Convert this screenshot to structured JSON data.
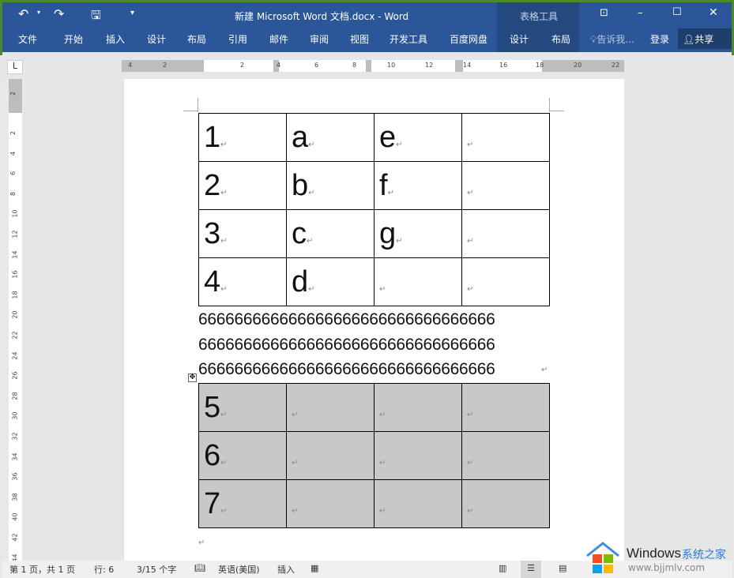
{
  "window": {
    "title": "新建 Microsoft Word 文档.docx - Word",
    "context_group": "表格工具"
  },
  "tabs": [
    "文件",
    "开始",
    "插入",
    "设计",
    "布局",
    "引用",
    "邮件",
    "审阅",
    "视图",
    "开发工具",
    "百度网盘"
  ],
  "context_tabs": [
    "设计",
    "布局"
  ],
  "tell_me": "告诉我...",
  "login": "登录",
  "share": "共享",
  "ruler": {
    "h_ticks": [
      "4",
      "2",
      "2",
      "4",
      "6",
      "8",
      "10",
      "12",
      "14",
      "16",
      "18",
      "20",
      "22"
    ],
    "v_ticks": [
      "2",
      "2",
      "4",
      "6",
      "8",
      "10",
      "12",
      "14",
      "16",
      "18",
      "20",
      "22",
      "24",
      "26",
      "28",
      "30",
      "32",
      "34",
      "36",
      "38",
      "40",
      "42",
      "44"
    ]
  },
  "table1": [
    [
      "1",
      "a",
      "e",
      ""
    ],
    [
      "2",
      "b",
      "f",
      ""
    ],
    [
      "3",
      "c",
      "g",
      ""
    ],
    [
      "4",
      "d",
      "",
      ""
    ]
  ],
  "paragraph": [
    "666666666666666666666666666666666",
    "666666666666666666666666666666666",
    "666666666666666666666666666666666"
  ],
  "table2": [
    [
      "5",
      "",
      "",
      ""
    ],
    [
      "6",
      "",
      "",
      ""
    ],
    [
      "7",
      "",
      "",
      ""
    ]
  ],
  "status": {
    "page": "第 1 页，共 1 页",
    "line": "行: 6",
    "words": "3/15 个字",
    "language": "英语(美国)",
    "mode": "插入"
  },
  "watermark": {
    "brand": "Windows",
    "suffix": "系统之家",
    "url": "www.bjjmlv.com"
  },
  "colors": {
    "ribbon": "#2b579a",
    "context": "#24497f",
    "shade": "#c8c8c8"
  }
}
